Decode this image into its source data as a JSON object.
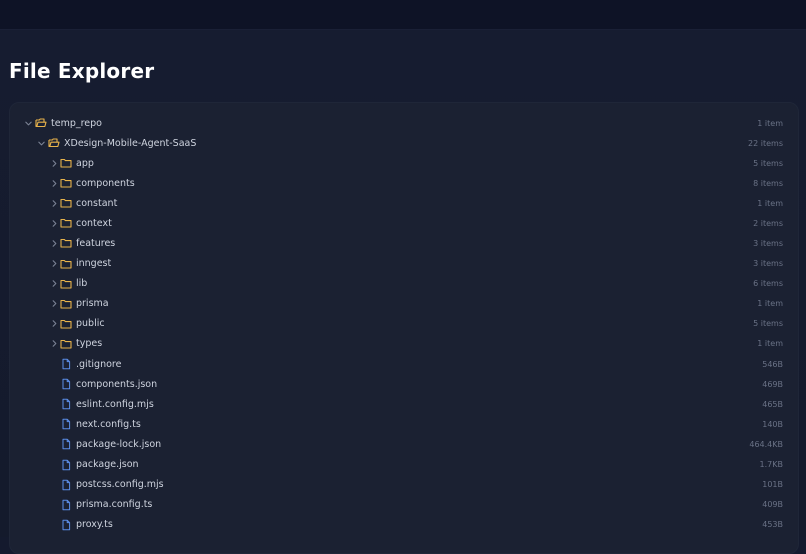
{
  "page": {
    "title": "File Explorer"
  },
  "colors": {
    "folder_icon": "#e8b34b",
    "file_icon": "#5b8ee8",
    "chevron": "#7c8496"
  },
  "tree": {
    "root": {
      "name": "temp_repo",
      "meta": "1 item",
      "expanded": true,
      "icon": "folder-open-icon"
    },
    "project": {
      "name": "XDesign-Mobile-Agent-SaaS",
      "meta": "22 items",
      "expanded": true,
      "icon": "folder-open-icon"
    },
    "entries": [
      {
        "type": "folder",
        "name": "app",
        "meta": "5 items"
      },
      {
        "type": "folder",
        "name": "components",
        "meta": "8 items"
      },
      {
        "type": "folder",
        "name": "constant",
        "meta": "1 item"
      },
      {
        "type": "folder",
        "name": "context",
        "meta": "2 items"
      },
      {
        "type": "folder",
        "name": "features",
        "meta": "3 items"
      },
      {
        "type": "folder",
        "name": "inngest",
        "meta": "3 items"
      },
      {
        "type": "folder",
        "name": "lib",
        "meta": "6 items"
      },
      {
        "type": "folder",
        "name": "prisma",
        "meta": "1 item"
      },
      {
        "type": "folder",
        "name": "public",
        "meta": "5 items"
      },
      {
        "type": "folder",
        "name": "types",
        "meta": "1 item"
      },
      {
        "type": "file",
        "name": ".gitignore",
        "meta": "546B"
      },
      {
        "type": "file",
        "name": "components.json",
        "meta": "469B"
      },
      {
        "type": "file",
        "name": "eslint.config.mjs",
        "meta": "465B"
      },
      {
        "type": "file",
        "name": "next.config.ts",
        "meta": "140B"
      },
      {
        "type": "file",
        "name": "package-lock.json",
        "meta": "464.4KB"
      },
      {
        "type": "file",
        "name": "package.json",
        "meta": "1.7KB"
      },
      {
        "type": "file",
        "name": "postcss.config.mjs",
        "meta": "101B"
      },
      {
        "type": "file",
        "name": "prisma.config.ts",
        "meta": "409B"
      },
      {
        "type": "file",
        "name": "proxy.ts",
        "meta": "453B"
      }
    ]
  }
}
